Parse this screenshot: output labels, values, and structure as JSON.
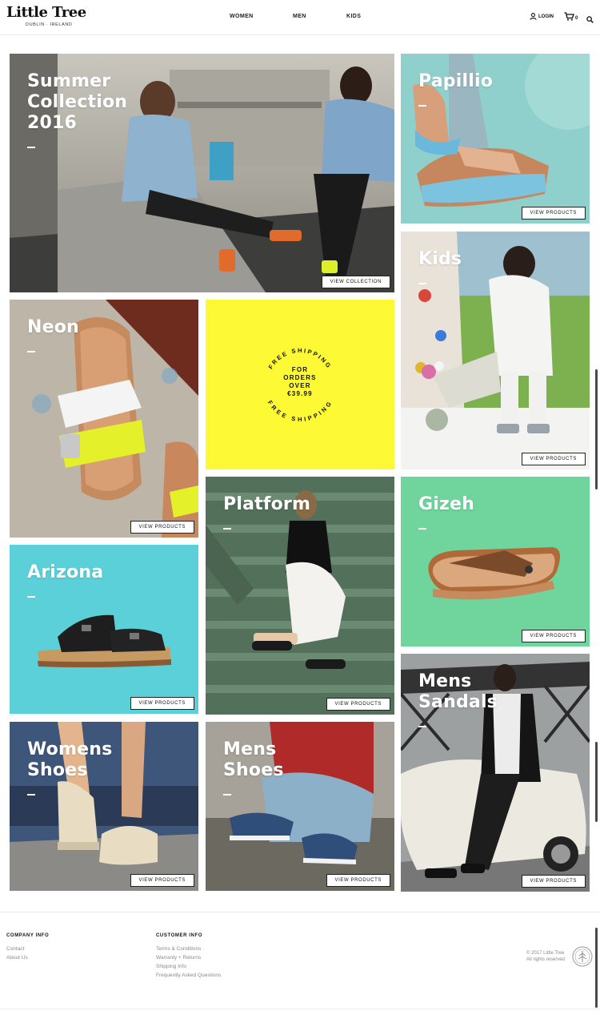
{
  "brand": {
    "name": "Little Tree",
    "tagline": "DUBLIN · IRELAND"
  },
  "nav": {
    "women": "WOMEN",
    "men": "MEN",
    "kids": "KIDS"
  },
  "header_actions": {
    "login": "LOGIN",
    "cart_count": "0",
    "icons": [
      "user-icon",
      "cart-icon",
      "search-icon"
    ]
  },
  "tiles": {
    "summer": {
      "title": "Summer\nCollection\n2016",
      "button": "VIEW COLLECTION"
    },
    "papillio": {
      "title": "Papillio",
      "button": "VIEW PRODUCTS"
    },
    "kids": {
      "title": "Kids",
      "button": "VIEW PRODUCTS"
    },
    "neon": {
      "title": "Neon",
      "button": "VIEW PRODUCTS"
    },
    "shipping": {
      "ring_text": "FREE SHIPPING",
      "line1": "FOR",
      "line2": "ORDERS",
      "line3": "OVER",
      "line4": "€39.99"
    },
    "platform": {
      "title": "Platform",
      "button": "VIEW PRODUCTS"
    },
    "gizeh": {
      "title": "Gizeh",
      "button": "VIEW PRODUCTS"
    },
    "arizona": {
      "title": "Arizona",
      "button": "VIEW PRODUCTS"
    },
    "mens_sandals": {
      "title": "Mens\nSandals",
      "button": "VIEW PRODUCTS"
    },
    "womens_shoes": {
      "title": "Womens\nShoes",
      "button": "VIEW PRODUCTS"
    },
    "mens_shoes": {
      "title": "Mens\nShoes",
      "button": "VIEW PRODUCTS"
    }
  },
  "colors": {
    "shipping_yellow": "#fdf934",
    "arizona_cyan": "#5bd0d8",
    "gizeh_green": "#6fd59c"
  },
  "footer": {
    "company_heading": "COMPANY INFO",
    "company_links": [
      "Contact",
      "About Us"
    ],
    "customer_heading": "CUSTOMER INFO",
    "customer_links": [
      "Terms & Conditions",
      "Warranty + Returns",
      "Shipping Info",
      "Frequently Asked Questions"
    ],
    "copyright_line1": "© 2017 Little Tree",
    "copyright_line2": "All rights reserved"
  }
}
